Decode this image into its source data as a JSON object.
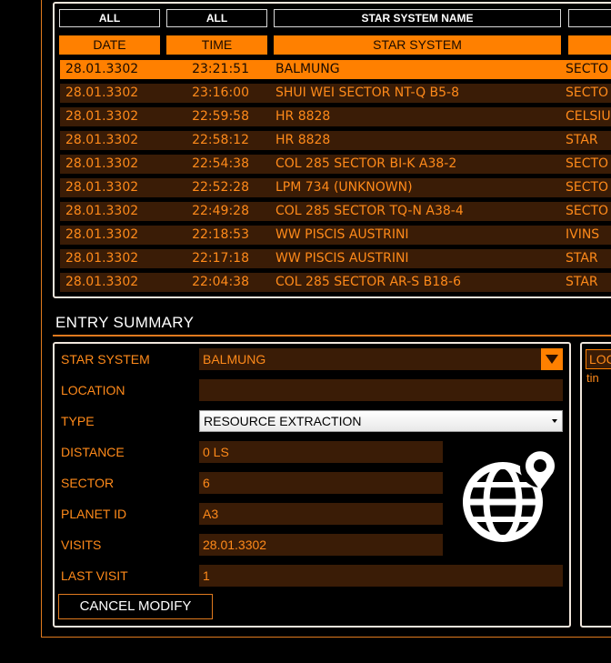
{
  "filters": [
    "ALL",
    "ALL",
    "STAR SYSTEM NAME",
    ""
  ],
  "columns": [
    "DATE",
    "TIME",
    "STAR SYSTEM",
    ""
  ],
  "rows": [
    {
      "date": "28.01.3302",
      "time": "23:21:51",
      "system": "BALMUNG",
      "loc": "SECTO",
      "selected": true
    },
    {
      "date": "28.01.3302",
      "time": "23:16:00",
      "system": "SHUI WEI SECTOR NT-Q B5-8",
      "loc": "SECTO",
      "selected": false
    },
    {
      "date": "28.01.3302",
      "time": "22:59:58",
      "system": "HR 8828",
      "loc": "CELSIU",
      "selected": false
    },
    {
      "date": "28.01.3302",
      "time": "22:58:12",
      "system": "HR 8828",
      "loc": "STAR",
      "selected": false
    },
    {
      "date": "28.01.3302",
      "time": "22:54:38",
      "system": "COL 285 SECTOR BI-K A38-2",
      "loc": "SECTO",
      "selected": false
    },
    {
      "date": "28.01.3302",
      "time": "22:52:28",
      "system": "LPM 734 (UNKNOWN)",
      "loc": "SECTO",
      "selected": false
    },
    {
      "date": "28.01.3302",
      "time": "22:49:28",
      "system": "COL 285 SECTOR TQ-N A38-4",
      "loc": "SECTO",
      "selected": false
    },
    {
      "date": "28.01.3302",
      "time": "22:18:53",
      "system": "WW PISCIS AUSTRINI",
      "loc": "IVINS",
      "selected": false
    },
    {
      "date": "28.01.3302",
      "time": "22:17:18",
      "system": "WW PISCIS AUSTRINI",
      "loc": "STAR",
      "selected": false
    },
    {
      "date": "28.01.3302",
      "time": "22:04:38",
      "system": "COL 285 SECTOR AR-S B18-6",
      "loc": "STAR",
      "selected": false
    }
  ],
  "summary": {
    "title": "ENTRY SUMMARY",
    "labels": {
      "star_system": "STAR SYSTEM",
      "location": "LOCATION",
      "type": "TYPE",
      "distance": "DISTANCE",
      "sector": "SECTOR",
      "planet_id": "PLANET ID",
      "visits": "VISITS",
      "last_visit": "LAST VISIT"
    },
    "values": {
      "star_system": "BALMUNG",
      "location": "",
      "type": "RESOURCE EXTRACTION",
      "distance": "0 LS",
      "sector": "6",
      "planet_id": "A3",
      "visits": "28.01.3302",
      "last_visit": "1"
    },
    "cancel_label": "CANCEL MODIFY"
  },
  "right_panel": {
    "tag": "LOC",
    "note": "tin"
  },
  "colors": {
    "accent": "#ff8000",
    "text": "#ff8a1a",
    "row_bg": "#3a1c06",
    "background": "#000000"
  },
  "icons": {
    "globe": "globe-location-icon",
    "dropdown": "chevron-down-icon"
  }
}
